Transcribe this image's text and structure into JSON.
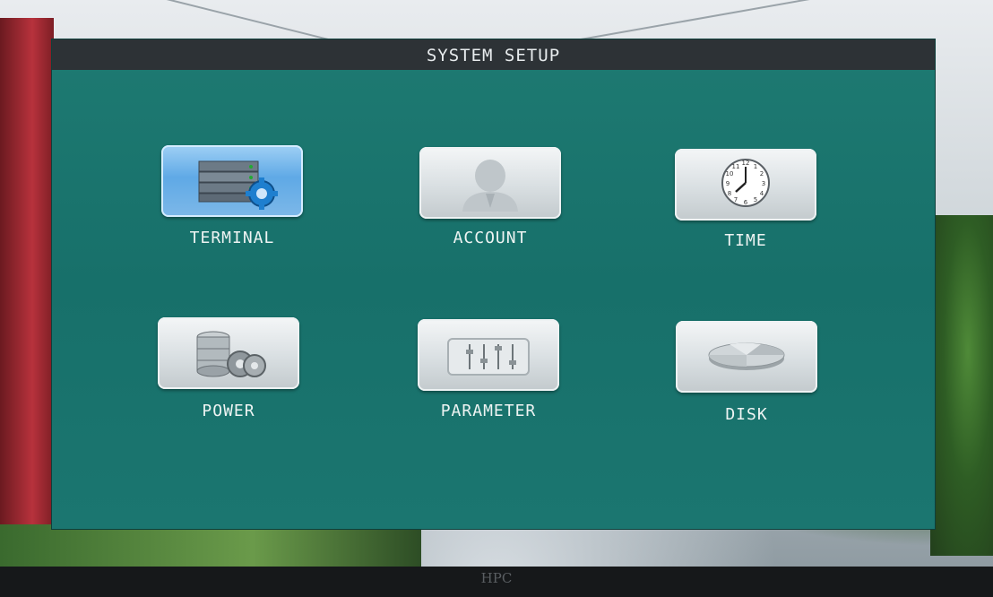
{
  "dialog": {
    "title": "SYSTEM SETUP"
  },
  "menu": {
    "items": [
      {
        "label": "TERMINAL",
        "icon": "server-gear-icon",
        "selected": true
      },
      {
        "label": "ACCOUNT",
        "icon": "user-icon",
        "selected": false
      },
      {
        "label": "TIME",
        "icon": "clock-icon",
        "selected": false
      },
      {
        "label": "POWER",
        "icon": "database-gear-icon",
        "selected": false
      },
      {
        "label": "PARAMETER",
        "icon": "sliders-icon",
        "selected": false
      },
      {
        "label": "DISK",
        "icon": "pie-disk-icon",
        "selected": false
      }
    ]
  },
  "monitor": {
    "brand": "HPC"
  },
  "colors": {
    "osd_background": "#17706a",
    "title_bar": "#2d3236",
    "selected_tile": "#5fa9e6",
    "tile": "#d9dfe2"
  }
}
